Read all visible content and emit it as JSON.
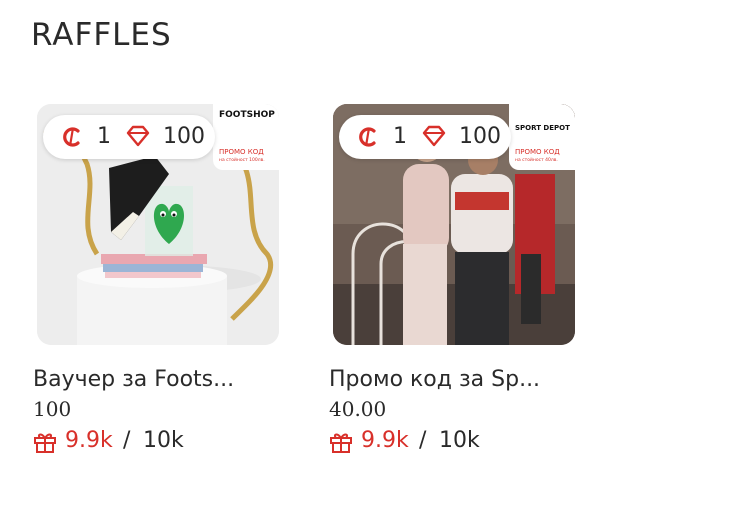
{
  "section": {
    "title": "RAFFLES"
  },
  "raffles": [
    {
      "name": "Ваучер за Foots...",
      "value": "100",
      "coin_cost": "1",
      "gem_cost": "100",
      "entries_current": "9.9k",
      "entries_separator": "/",
      "entries_total": "10k",
      "brand": "FOOTSHOP",
      "promo_label": "ПРОМО КОД",
      "promo_sub": "на стойност 100лв."
    },
    {
      "name": "Промо код за Sp...",
      "value": "40.00",
      "coin_cost": "1",
      "gem_cost": "100",
      "entries_current": "9.9k",
      "entries_separator": "/",
      "entries_total": "10k",
      "brand": "SPORT DEPOT",
      "promo_label": "ПРОМО КОД",
      "promo_sub": "на стойност 40лв."
    }
  ],
  "icons": {
    "coin": "coin-icon",
    "gem": "gem-icon",
    "gift": "gift-icon"
  },
  "colors": {
    "accent": "#d8302a",
    "text": "#2a2a2a"
  }
}
